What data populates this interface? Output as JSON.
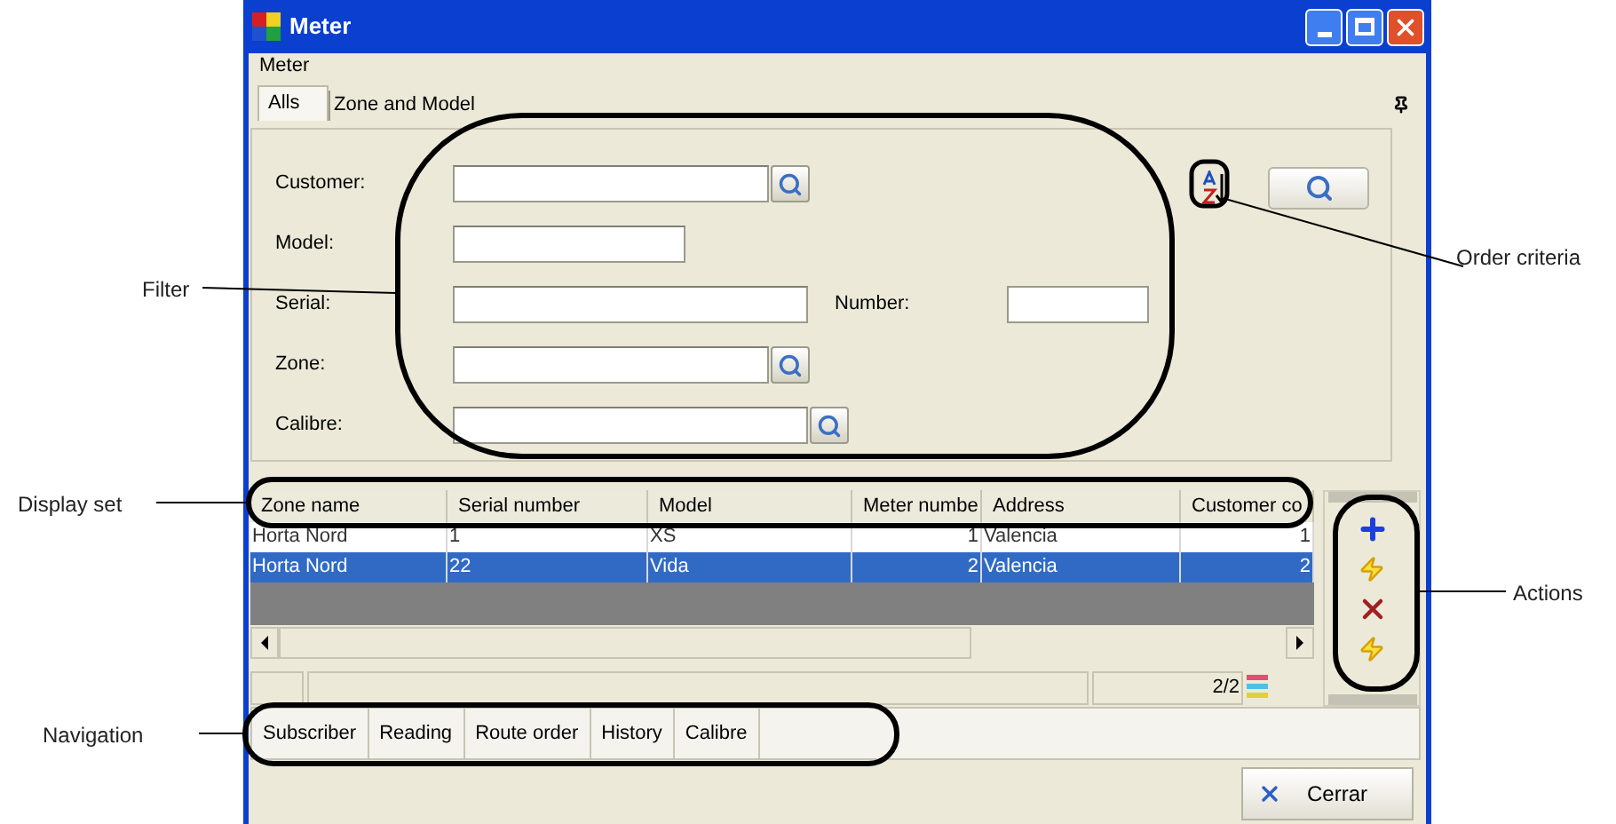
{
  "window": {
    "title": "Meter"
  },
  "group_label": "Meter",
  "tabs": [
    {
      "label": "Alls",
      "selected": true
    },
    {
      "label": "Zone and Model",
      "selected": false
    }
  ],
  "filter": [
    {
      "label": "Customer:",
      "kind": "lookup"
    },
    {
      "label": "Model:",
      "kind": "short"
    },
    {
      "label": "Serial:",
      "kind": "wide",
      "extra_label": "Number:"
    },
    {
      "label": "Zone:",
      "kind": "lookup"
    },
    {
      "label": "Calibre:",
      "kind": "lookup_wide"
    }
  ],
  "table": {
    "columns": [
      "Zone name",
      "Serial number",
      "Model",
      "Meter numbe",
      "Address",
      "Customer co"
    ],
    "rows": [
      {
        "cells": [
          "Horta Nord",
          "1",
          "XS",
          "1",
          "Valencia",
          "1"
        ],
        "selected": false
      },
      {
        "cells": [
          "Horta Nord",
          "22",
          "Vida",
          "2",
          "Valencia",
          "2"
        ],
        "selected": true
      }
    ]
  },
  "status_bar": {
    "counter": "2/2"
  },
  "navigation": [
    "Subscriber",
    "Reading",
    "Route order",
    "History",
    "Calibre"
  ],
  "close_button": "Cerrar",
  "annotations": [
    "Filter",
    "Display set",
    "Navigation",
    "Order criteria",
    "Actions"
  ]
}
